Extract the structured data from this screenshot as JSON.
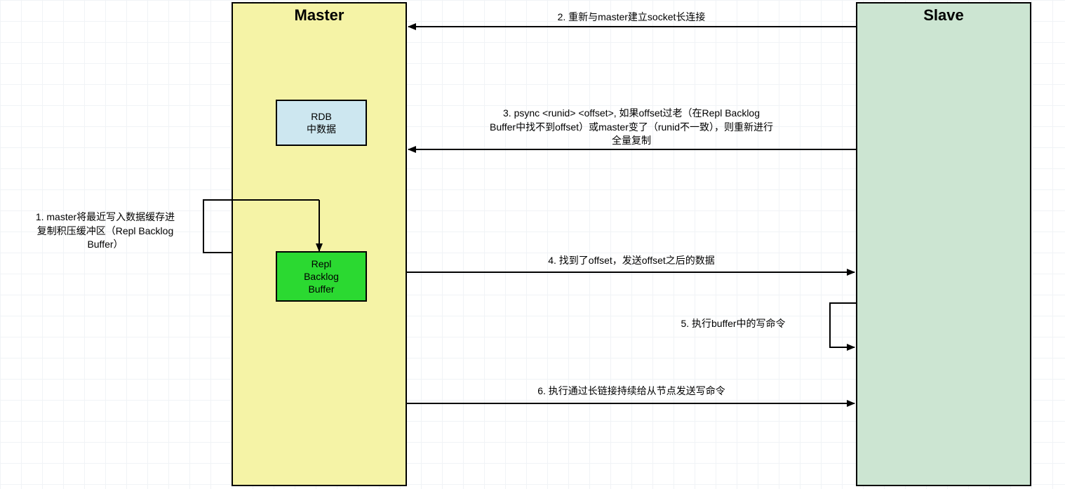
{
  "master": {
    "title": "Master"
  },
  "slave": {
    "title": "Slave"
  },
  "rdb": {
    "line1": "RDB",
    "line2": "中数据"
  },
  "buffer": {
    "line1": "Repl",
    "line2": "Backlog",
    "line3": "Buffer"
  },
  "step1": "1. master将最近写入数据缓存进\n复制积压缓冲区（Repl Backlog\nBuffer）",
  "step2": "2. 重新与master建立socket长连接",
  "step3": "3. psync <runid> <offset>, 如果offset过老（在Repl Backlog\nBuffer中找不到offset）或master变了（runid不一致），则重新进行\n全量复制",
  "step4": "4. 找到了offset，发送offset之后的数据",
  "step5": "5. 执行buffer中的写命令",
  "step6": "6. 执行通过长链接持续给从节点发送写命令"
}
